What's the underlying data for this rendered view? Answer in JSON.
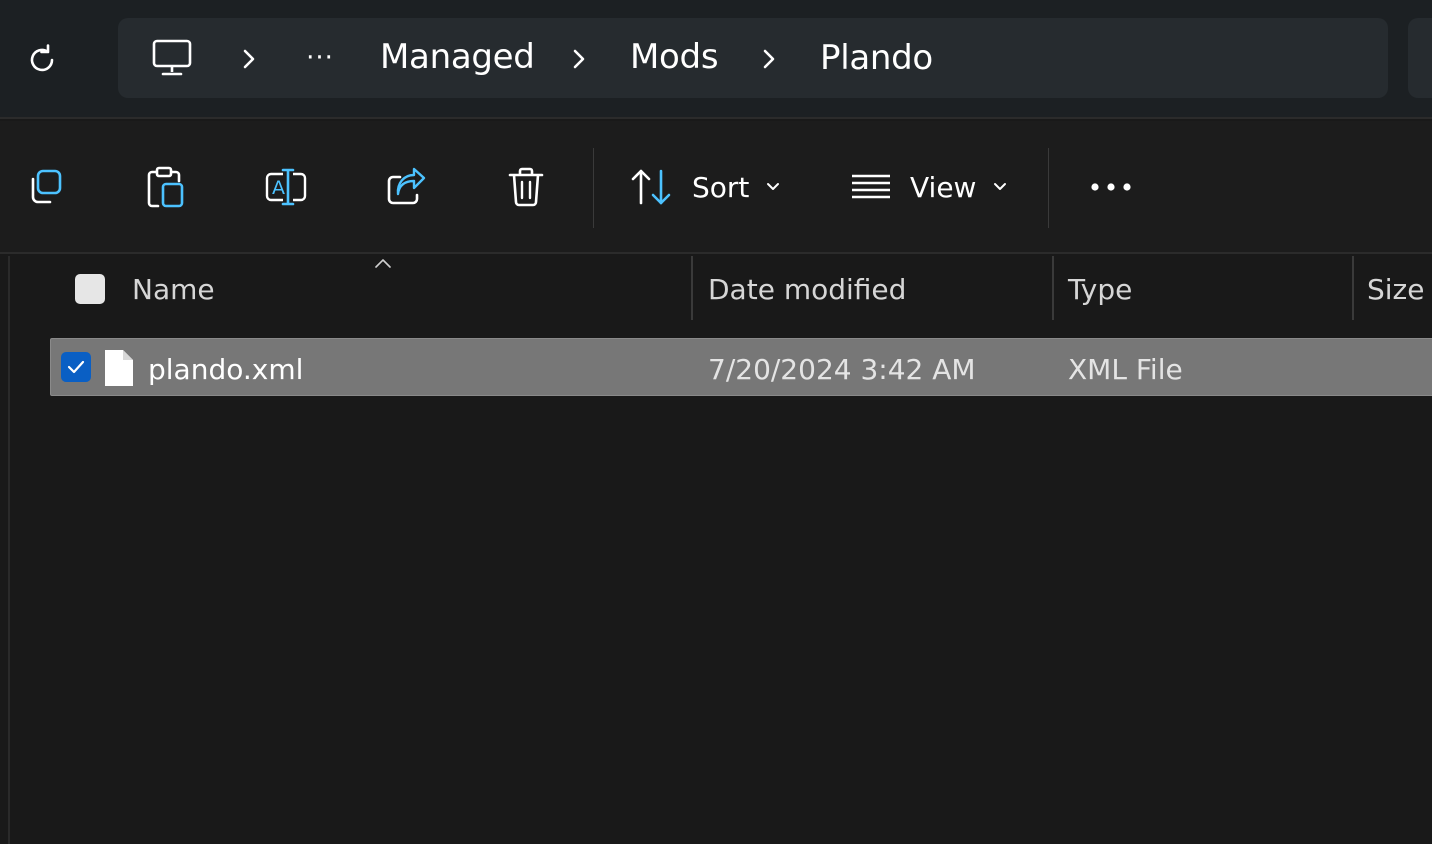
{
  "address_bar": {
    "overflow_label": "···",
    "breadcrumbs": [
      {
        "label": "Managed"
      },
      {
        "label": "Mods"
      },
      {
        "label": "Plando"
      }
    ]
  },
  "command_bar": {
    "sort_label": "Sort",
    "view_label": "View"
  },
  "columns": {
    "name": "Name",
    "date_modified": "Date modified",
    "type": "Type",
    "size": "Size"
  },
  "files": [
    {
      "name": "plando.xml",
      "date_modified": "7/20/2024 3:42 AM",
      "type": "XML File",
      "size": "",
      "selected": true
    }
  ],
  "colors": {
    "accent": "#0a5fc4",
    "selection": "#777777",
    "icon_blue": "#4cc2ff"
  }
}
